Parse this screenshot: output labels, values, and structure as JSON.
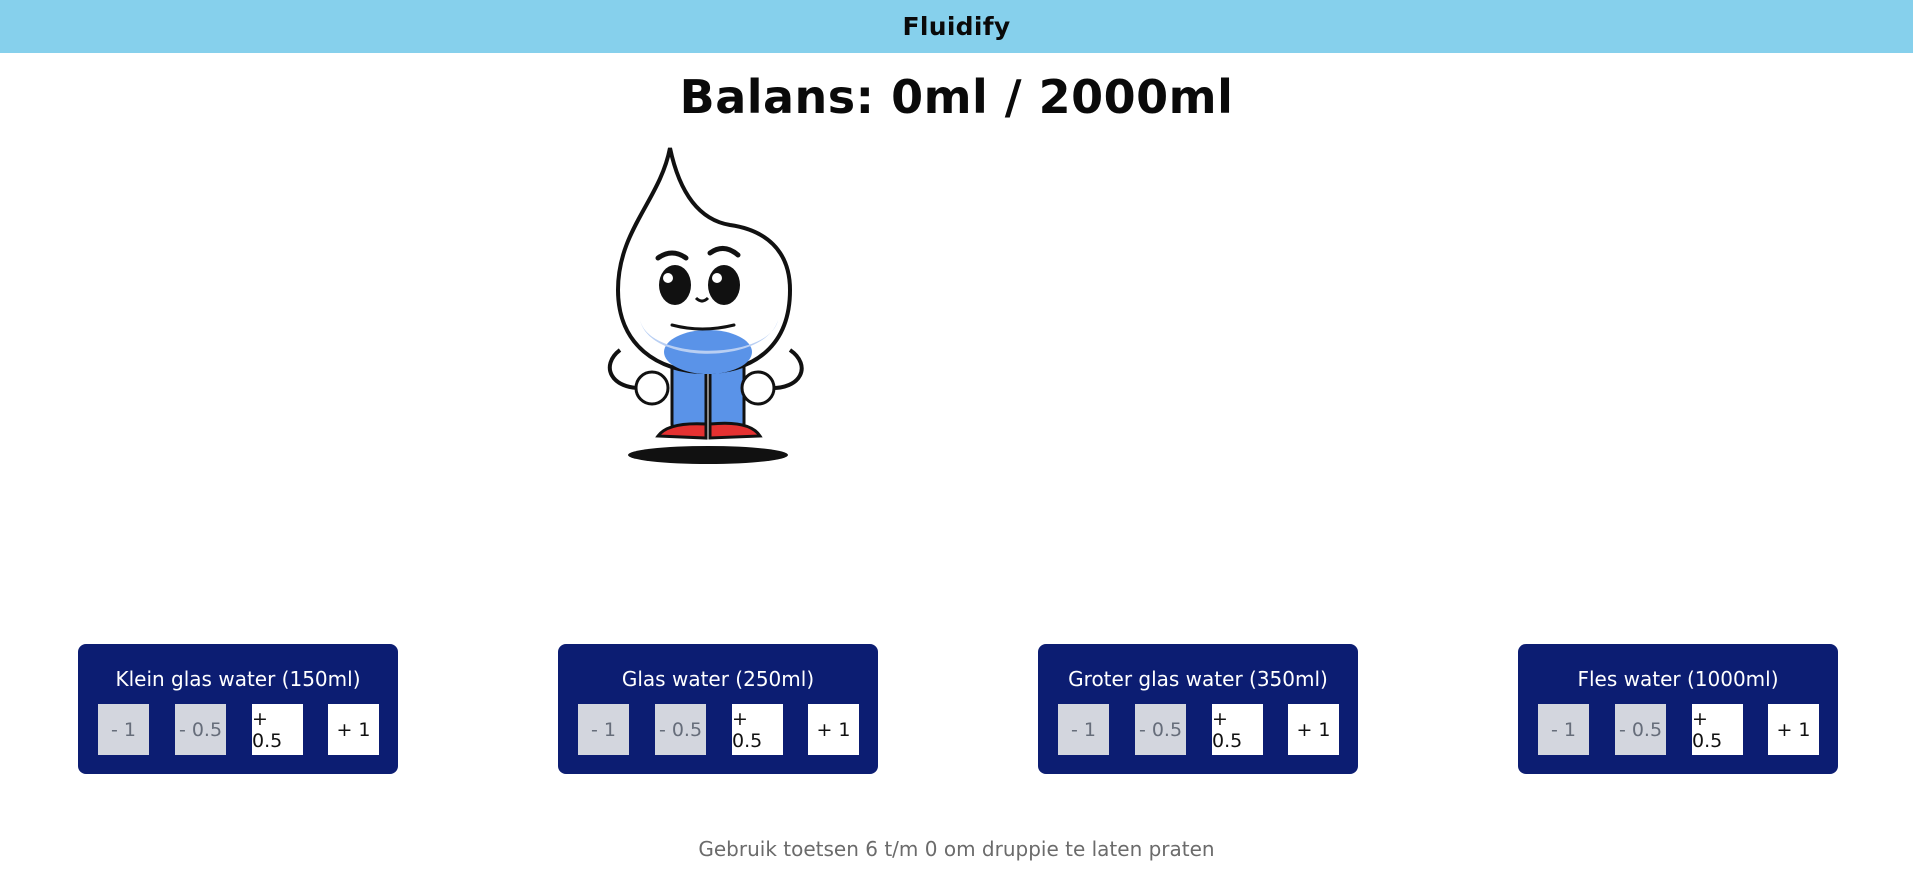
{
  "app": {
    "title": "Fluidify"
  },
  "balance": {
    "text": "Balans: 0ml / 2000ml"
  },
  "cards": [
    {
      "title": "Klein glas water (150ml)",
      "buttons": [
        "- 1",
        "- 0.5",
        "+ 0.5",
        "+ 1"
      ]
    },
    {
      "title": "Glas water (250ml)",
      "buttons": [
        "- 1",
        "- 0.5",
        "+ 0.5",
        "+ 1"
      ]
    },
    {
      "title": "Groter glas water (350ml)",
      "buttons": [
        "- 1",
        "- 0.5",
        "+ 0.5",
        "+ 1"
      ]
    },
    {
      "title": "Fles water (1000ml)",
      "buttons": [
        "- 1",
        "- 0.5",
        "+ 0.5",
        "+ 1"
      ]
    }
  ],
  "footer": {
    "hint": "Gebruik toetsen 6 t/m 0 om druppie te laten praten"
  },
  "colors": {
    "header": "#86d0ec",
    "card": "#0c1d72",
    "button_disabled": "#d3d6de"
  },
  "icons": {
    "mascot": "water-drop-mascot"
  }
}
